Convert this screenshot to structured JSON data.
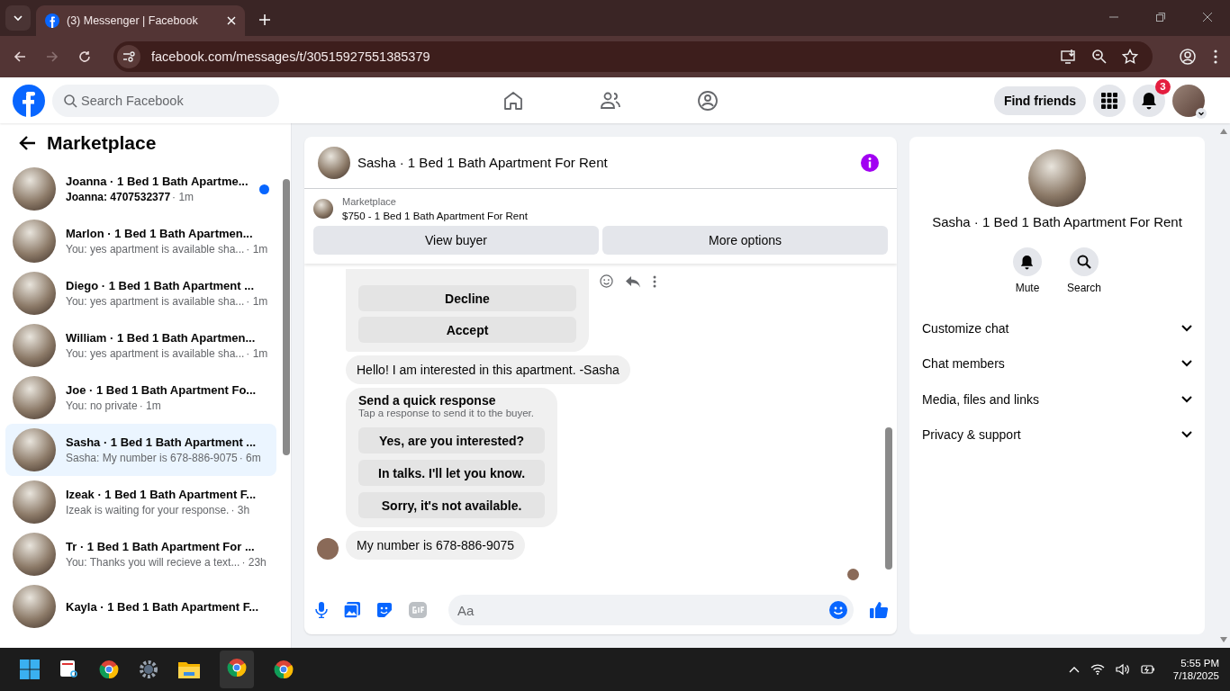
{
  "browser": {
    "tab_title": "(3) Messenger | Facebook",
    "url": "facebook.com/messages/t/30515927551385379"
  },
  "topbar": {
    "search_placeholder": "Search Facebook",
    "find_friends": "Find friends",
    "notification_count": "3"
  },
  "sidebar": {
    "title": "Marketplace",
    "conversations": [
      {
        "title": "Joanna · 1 Bed 1 Bath Apartme...",
        "preview": "Joanna: 4707532377",
        "time": "· 1m",
        "unread": true,
        "selected": false
      },
      {
        "title": "Marlon · 1 Bed 1 Bath Apartmen...",
        "preview": "You: yes apartment is available sha...",
        "time": "· 1m",
        "unread": false,
        "selected": false
      },
      {
        "title": "Diego · 1 Bed 1 Bath Apartment ...",
        "preview": "You: yes apartment is available sha...",
        "time": "· 1m",
        "unread": false,
        "selected": false
      },
      {
        "title": "William · 1 Bed 1 Bath Apartmen...",
        "preview": "You: yes apartment is available sha...",
        "time": "· 1m",
        "unread": false,
        "selected": false
      },
      {
        "title": "Joe · 1 Bed 1 Bath Apartment Fo...",
        "preview": "You: no private",
        "time": "· 1m",
        "unread": false,
        "selected": false
      },
      {
        "title": "Sasha · 1 Bed 1 Bath Apartment ...",
        "preview": "Sasha: My number is 678-886-9075",
        "time": "· 6m",
        "unread": false,
        "selected": true
      },
      {
        "title": "Izeak · 1 Bed 1 Bath Apartment F...",
        "preview": "Izeak is waiting for your response.",
        "time": "· 3h",
        "unread": false,
        "selected": false
      },
      {
        "title": "Tr · 1 Bed 1 Bath Apartment For ...",
        "preview": "You: Thanks you will recieve a text...",
        "time": "· 23h",
        "unread": false,
        "selected": false
      },
      {
        "title": "Kayla · 1 Bed 1 Bath Apartment F...",
        "unread": false,
        "selected": false
      }
    ]
  },
  "chat": {
    "title": "Sasha · 1 Bed 1 Bath Apartment For Rent",
    "listing": {
      "source": "Marketplace",
      "title": "$750 - 1 Bed 1 Bath Apartment For Rent"
    },
    "buttons": [
      "View buyer",
      "More options"
    ],
    "messages": [
      {
        "kind": "actions",
        "options": [
          "Decline",
          "Accept"
        ]
      },
      {
        "kind": "text",
        "text": "Hello! I am interested in this apartment. -Sasha",
        "avatar": false
      },
      {
        "kind": "quick",
        "title": "Send a quick response",
        "subtitle": "Tap a response to send it to the buyer.",
        "options": [
          "Yes, are you interested?",
          "In talks. I'll let you know.",
          "Sorry, it's not available."
        ]
      },
      {
        "kind": "text",
        "text": "My number is 678-886-9075",
        "avatar": true
      }
    ],
    "composer_placeholder": "Aa"
  },
  "details": {
    "name": "Sasha · 1 Bed 1 Bath Apartment For Rent",
    "actions": [
      {
        "kind": "mute",
        "label": "Mute"
      },
      {
        "kind": "search",
        "label": "Search"
      }
    ],
    "sections": [
      "Customize chat",
      "Chat members",
      "Media, files and links",
      "Privacy & support"
    ]
  },
  "taskbar": {
    "time": "5:55 PM",
    "date": "7/18/2025"
  }
}
